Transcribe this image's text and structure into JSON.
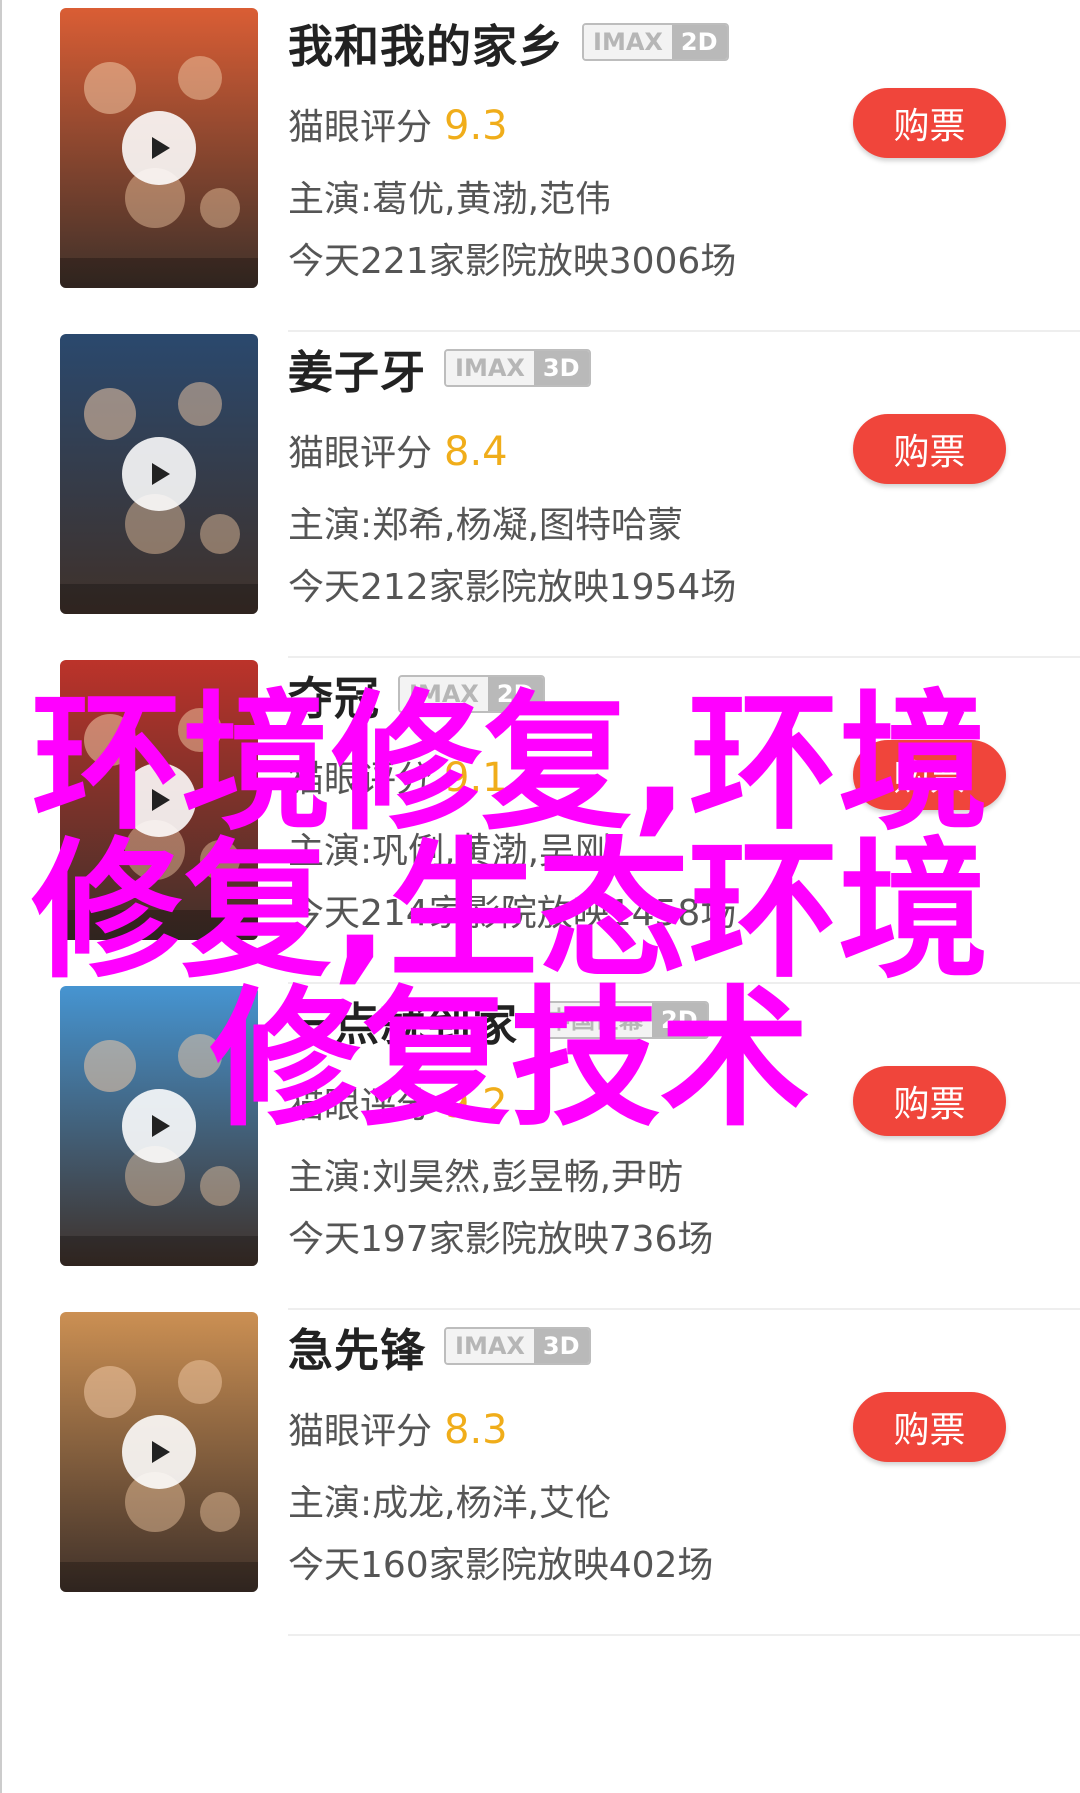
{
  "buy_label": "购票",
  "rating_label": "猫眼评分",
  "movies": [
    {
      "title": "我和我的家乡",
      "format": [
        "IMAX",
        "2D"
      ],
      "score": "9.3",
      "cast": "主演:葛优,黄渤,范伟",
      "showings": "今天221家影院放映3006场",
      "poster_color": "#d8552a"
    },
    {
      "title": "姜子牙",
      "format": [
        "IMAX",
        "3D"
      ],
      "score": "8.4",
      "cast": "主演:郑希,杨凝,图特哈蒙",
      "showings": "今天212家影院放映1954场",
      "poster_color": "#1f3f66"
    },
    {
      "title": "夺冠",
      "format": [
        "IMAX",
        "2D"
      ],
      "score": "9.1",
      "cast": "主演:巩俐,黄渤,吴刚",
      "showings": "今天214家影院放映1458场",
      "poster_color": "#b8281f"
    },
    {
      "title": "一点就到家",
      "format": [
        "中国巨幕",
        "2D"
      ],
      "score": "9.2",
      "cast": "主演:刘昊然,彭昱畅,尹昉",
      "showings": "今天197家影院放映736场",
      "poster_color": "#3c8fcf"
    },
    {
      "title": "急先锋",
      "format": [
        "IMAX",
        "3D"
      ],
      "score": "8.3",
      "cast": "主演:成龙,杨洋,艾伦",
      "showings": "今天160家影院放映402场",
      "poster_color": "#c98a4a"
    }
  ],
  "watermark": {
    "line1": "环境修复,环境",
    "line2": "修复,生态环境",
    "line3": "修复技术",
    "color": "#ff00ff"
  }
}
